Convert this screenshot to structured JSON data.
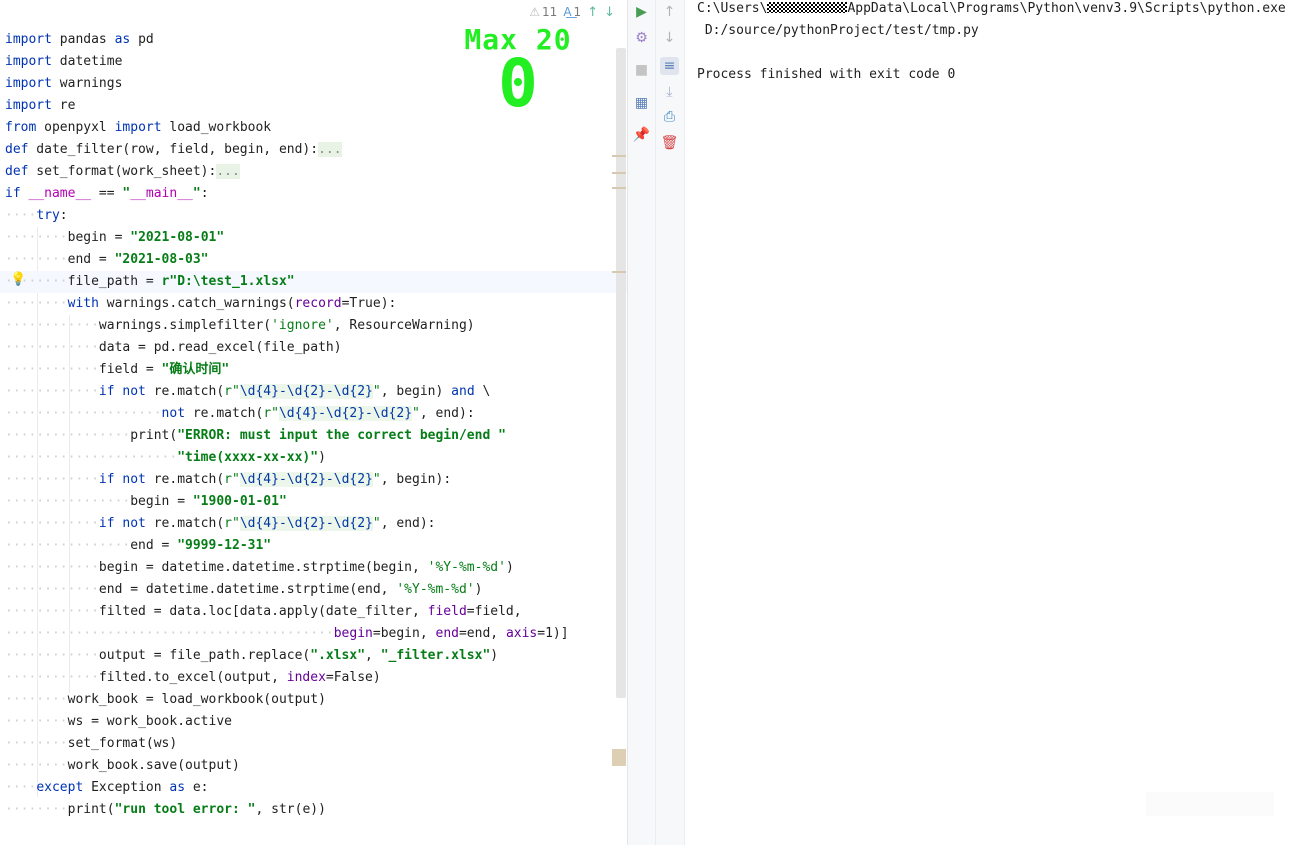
{
  "inspection": {
    "warnings_count": "11",
    "typos_count": "1"
  },
  "overlay": {
    "max_label": "Max 20",
    "counter": "0"
  },
  "console": {
    "command_prefix": "C:\\Users\\",
    "command_suffix": "AppData\\Local\\Programs\\Python\\venv3.9\\Scripts\\python.exe",
    "script_path": " D:/source/pythonProject/test/tmp.py",
    "exit_message": "Process finished with exit code 0"
  },
  "code_lines": [
    "import pandas as pd",
    "import datetime",
    "import warnings",
    "import re",
    "from openpyxl import load_workbook",
    "def date_filter(row, field, begin, end):...",
    "def set_format(work_sheet):...",
    "if __name__ == \"__main__\":",
    "    try:",
    "        begin = \"2021-08-01\"",
    "        end = \"2021-08-03\"",
    "        file_path = r\"D:\\test_1.xlsx\"",
    "        with warnings.catch_warnings(record=True):",
    "            warnings.simplefilter('ignore', ResourceWarning)",
    "            data = pd.read_excel(file_path)",
    "            field = \"确认时间\"",
    "            if not re.match(r\"\\d{4}-\\d{2}-\\d{2}\", begin) and \\",
    "                    not re.match(r\"\\d{4}-\\d{2}-\\d{2}\", end):",
    "                print(\"ERROR: must input the correct begin/end \"",
    "                      \"time(xxxx-xx-xx)\")",
    "            if not re.match(r\"\\d{4}-\\d{2}-\\d{2}\", begin):",
    "                begin = \"1900-01-01\"",
    "            if not re.match(r\"\\d{4}-\\d{2}-\\d{2}\", end):",
    "                end = \"9999-12-31\"",
    "            begin = datetime.datetime.strptime(begin, '%Y-%m-%d')",
    "            end = datetime.datetime.strptime(end, '%Y-%m-%d')",
    "            filted = data.loc[data.apply(date_filter, field=field,",
    "                                          begin=begin, end=end, axis=1)]",
    "            output = file_path.replace(\".xlsx\", \"_filter.xlsx\")",
    "            filted.to_excel(output, index=False)",
    "        work_book = load_workbook(output)",
    "        ws = work_book.active",
    "        set_format(ws)",
    "        work_book.save(output)",
    "    except Exception as e:",
    "        print(\"run tool error: \", str(e))"
  ],
  "icons": {
    "warning": "warning-triangle-icon",
    "typo": "typo-icon",
    "bulb": "lightbulb-icon",
    "run": "rerun-icon",
    "settings": "gear-icon",
    "stop": "stop-icon",
    "layout": "layout-icon",
    "pin": "pin-icon",
    "up": "up-arrow-icon",
    "down": "down-arrow-icon",
    "soft_wrap": "soft-wrap-icon",
    "scroll_end": "scroll-to-end-icon",
    "print": "print-icon",
    "trash": "trash-icon"
  }
}
